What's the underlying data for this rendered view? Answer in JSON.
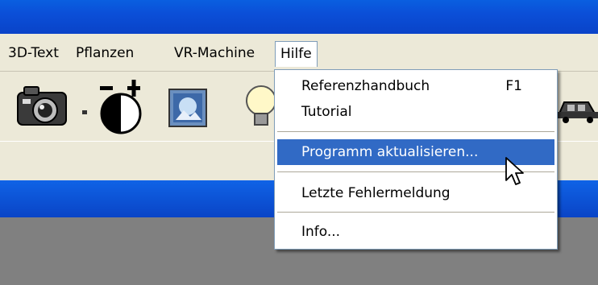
{
  "menubar": {
    "items": [
      "3D-Text",
      "Pflanzen",
      "VR-Machine",
      "Hilfe"
    ]
  },
  "hilfe_menu": {
    "items": [
      {
        "label": "Referenzhandbuch",
        "shortcut": "F1"
      },
      {
        "label": "Tutorial"
      },
      {
        "label": "Programm aktualisieren..."
      },
      {
        "label": "Letzte Fehlermeldung"
      },
      {
        "label": "Info..."
      }
    ],
    "highlight_color": "#316ac5"
  },
  "toolbar": {
    "icons": [
      "camera-icon",
      "dropdown-arrow-icon",
      "contrast-adjust-icon",
      "photo-icon",
      "light-bulb-icon",
      "car-icon"
    ]
  },
  "colors": {
    "titlebar": "#0b4fd8",
    "menubar": "#ece9d8",
    "workspace": "#808080"
  }
}
